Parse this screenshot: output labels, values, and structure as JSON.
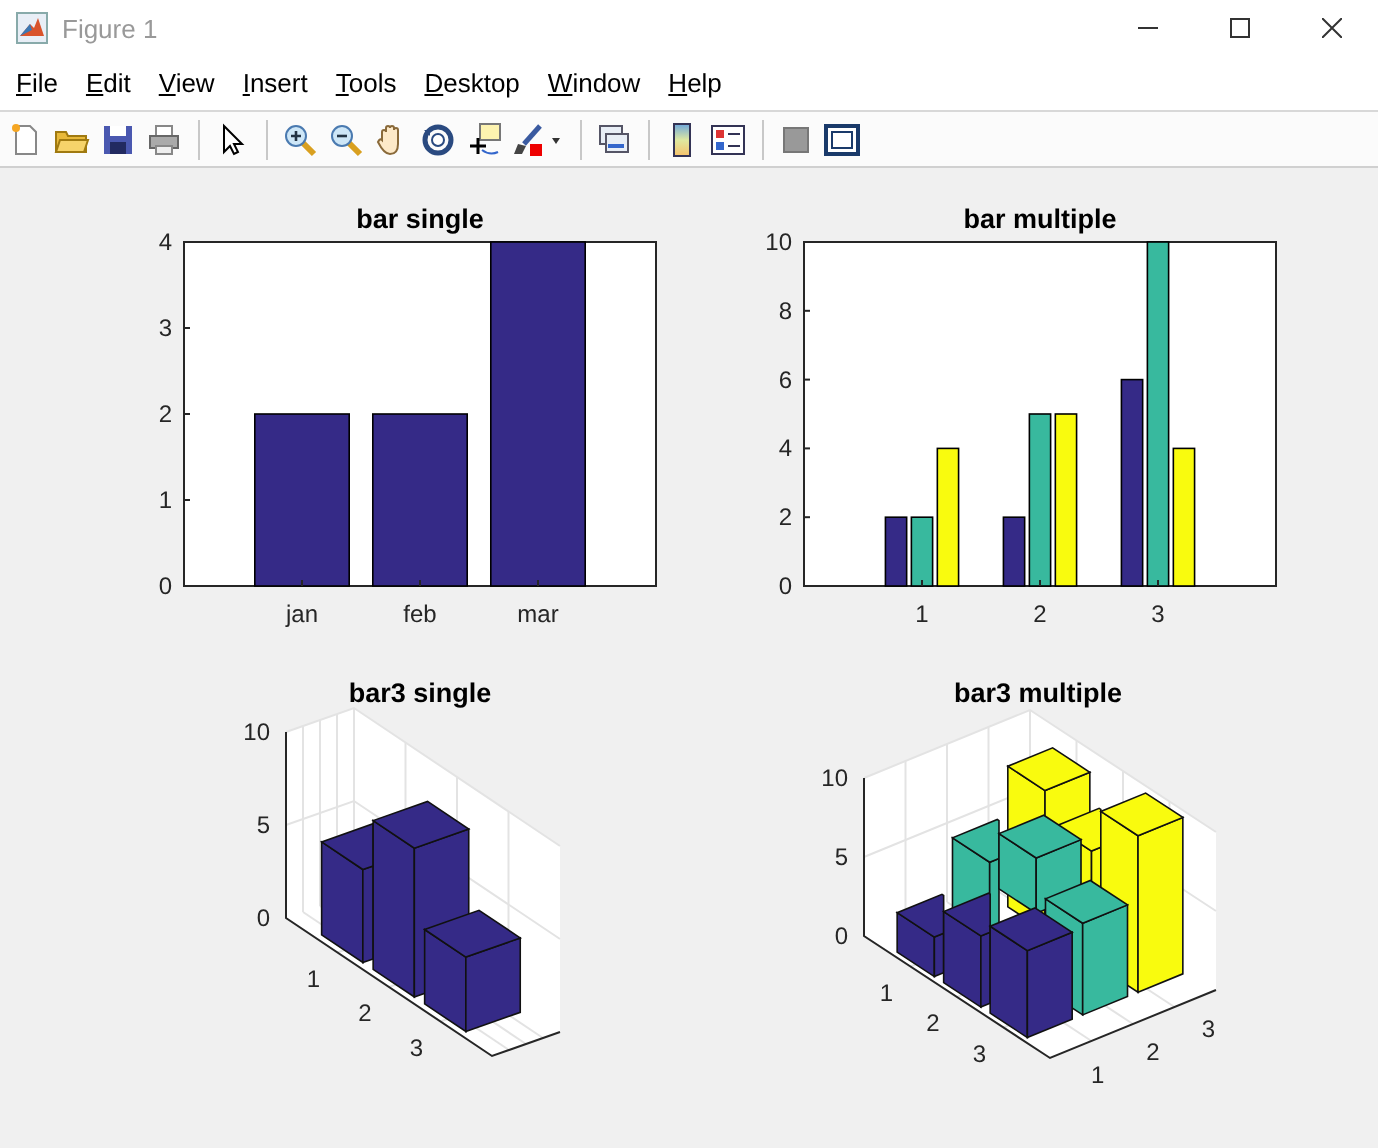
{
  "window": {
    "title": "Figure 1"
  },
  "menu": [
    "File",
    "Edit",
    "View",
    "Insert",
    "Tools",
    "Desktop",
    "Window",
    "Help"
  ],
  "charts": [
    {
      "kind": "bar",
      "chart_data": {
        "type": "bar",
        "title": "bar single",
        "categories": [
          "jan",
          "feb",
          "mar"
        ],
        "series": [
          {
            "color": "#352a87",
            "values": [
              2,
              2,
              4
            ]
          }
        ],
        "ylim": [
          0,
          4
        ],
        "yticks": [
          0,
          1,
          2,
          3,
          4
        ]
      }
    },
    {
      "kind": "bar",
      "chart_data": {
        "type": "bar",
        "title": "bar multiple",
        "categories": [
          "1",
          "2",
          "3"
        ],
        "series": [
          {
            "color": "#352a87",
            "values": [
              2,
              2,
              6
            ]
          },
          {
            "color": "#38b99e",
            "values": [
              2,
              5,
              10
            ]
          },
          {
            "color": "#f9fb0e",
            "values": [
              4,
              5,
              4
            ]
          }
        ],
        "ylim": [
          0,
          10
        ],
        "yticks": [
          0,
          2,
          4,
          6,
          8,
          10
        ]
      }
    },
    {
      "kind": "bar3",
      "title": "bar3 single",
      "zticks": [
        "10",
        "5",
        "0"
      ],
      "row_labels": [
        "1",
        "2",
        "3"
      ]
    },
    {
      "kind": "bar3",
      "title": "bar3 multiple",
      "zticks": [
        "10",
        "5",
        "0"
      ],
      "row_labels": [
        "1",
        "2",
        "3"
      ],
      "column_labels": [
        "1",
        "2",
        "3"
      ]
    }
  ]
}
